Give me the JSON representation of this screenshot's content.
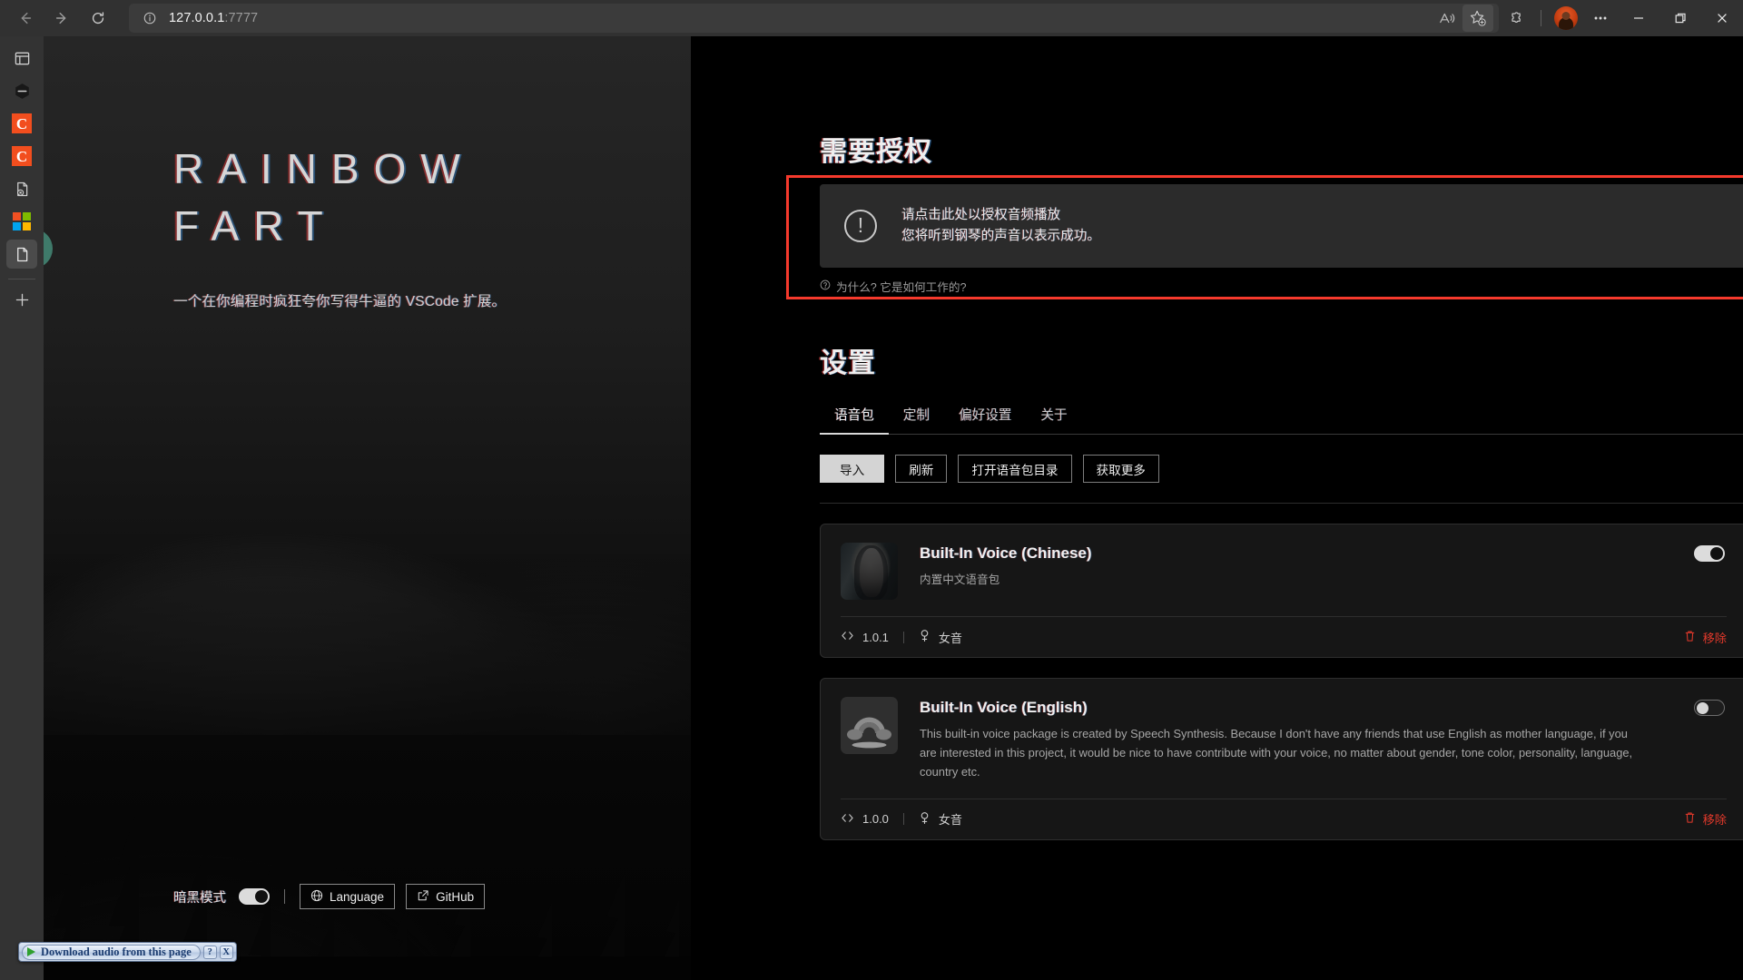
{
  "browser": {
    "url_host": "127.0.0.1",
    "url_port": ":7777",
    "back_icon": "back-arrow-icon",
    "forward_icon": "forward-arrow-icon",
    "reload_icon": "reload-icon",
    "info_icon": "site-info-icon",
    "read_aloud_icon": "read-aloud-icon",
    "favorite_icon": "add-favorite-star-icon",
    "extensions_icon": "extensions-puzzle-icon",
    "profile_icon": "profile-avatar",
    "more_icon": "more-options-ellipsis-icon",
    "minimize_icon": "minimize-icon",
    "restore_icon": "restore-icon",
    "close_icon": "close-icon"
  },
  "activity_bar": {
    "items": [
      {
        "name": "layout-panel-icon",
        "kind": "panel"
      },
      {
        "name": "block-hexagon-icon",
        "kind": "hexagon"
      },
      {
        "name": "c-badge-icon-1",
        "kind": "c",
        "label": "C",
        "color": "#f24e1e"
      },
      {
        "name": "c-badge-icon-2",
        "kind": "c",
        "label": "C",
        "color": "#f24e1e"
      },
      {
        "name": "file-error-icon",
        "kind": "file-x"
      },
      {
        "name": "microsoft-grid-icon",
        "kind": "ms"
      },
      {
        "name": "document-icon",
        "kind": "doc",
        "selected": true
      }
    ],
    "add_icon": "add-plus-icon"
  },
  "hero": {
    "title_line1": "RAINBOW",
    "title_line2": "FART",
    "subtitle": "一个在你编程时疯狂夸你写得牛逼的 VSCode 扩展。",
    "dark_mode_label": "暗黑模式",
    "dark_mode_on": true,
    "language_button": "Language",
    "language_icon": "globe-icon",
    "github_button": "GitHub",
    "github_icon": "external-link-icon"
  },
  "auth": {
    "heading": "需要授权",
    "icon": "exclamation-circle-icon",
    "line1": "请点击此处以授权音频播放",
    "line2": "您将听到钢琴的声音以表示成功。",
    "why_link": "为什么? 它是如何工作的?",
    "why_icon": "question-circle-icon",
    "highlight_color": "#f5392c"
  },
  "settings": {
    "heading": "设置",
    "tabs": [
      {
        "label": "语音包",
        "active": true
      },
      {
        "label": "定制",
        "active": false
      },
      {
        "label": "偏好设置",
        "active": false
      },
      {
        "label": "关于",
        "active": false
      }
    ],
    "buttons": [
      {
        "label": "导入",
        "primary": true
      },
      {
        "label": "刷新",
        "primary": false
      },
      {
        "label": "打开语音包目录",
        "primary": false
      },
      {
        "label": "获取更多",
        "primary": false
      }
    ]
  },
  "voice_packs": [
    {
      "title": "Built-In Voice (Chinese)",
      "description": "内置中文语音包",
      "description_zh": true,
      "thumbnail": "portrait-photo-thumbnail",
      "enabled": true,
      "version": "1.0.1",
      "version_icon": "code-brackets-icon",
      "gender": "女音",
      "gender_icon": "female-symbol-icon",
      "remove_label": "移除",
      "remove_icon": "trash-icon",
      "remove_color": "#e1392b"
    },
    {
      "title": "Built-In Voice (English)",
      "description": "This built-in voice package is created by Speech Synthesis. Because I don't have any friends that use English as mother language, if you are interested in this project, it would be nice to have contribute with your voice, no matter about gender, tone color, personality, language, country etc.",
      "description_zh": false,
      "thumbnail": "rainbow-cloud-logo-thumbnail",
      "enabled": false,
      "version": "1.0.0",
      "version_icon": "code-brackets-icon",
      "gender": "女音",
      "gender_icon": "female-symbol-icon",
      "remove_label": "移除",
      "remove_icon": "trash-icon",
      "remove_color": "#e1392b"
    }
  ],
  "download_widget": {
    "label": "Download audio from this page",
    "play_icon": "play-triangle-icon",
    "help_label": "?",
    "close_label": "X"
  }
}
